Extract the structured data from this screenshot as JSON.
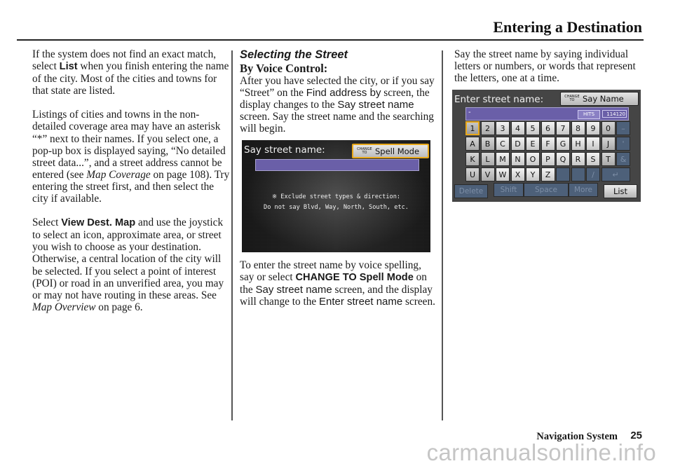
{
  "header": {
    "title": "Entering a Destination"
  },
  "column1": {
    "para1": {
      "before": "If the system does not find an exact match, select ",
      "bold": "List",
      "after": " when you finish entering the name of the city. Most of the cities and towns for that state are listed."
    },
    "para2": {
      "before": "Listings of cities and towns in the non-detailed coverage area may have an asterisk “*” next to their names. If you select one, a pop-up box is displayed saying, “No detailed street data...”, and a street address cannot be entered (see ",
      "italic": "Map Coverage",
      "after": " on page 108). Try entering the street first, and then select the city if available."
    },
    "para3": {
      "before": "Select ",
      "bold": "View Dest. Map",
      "middle": " and use the joystick to select an icon, approximate area, or street you wish to choose as your destination. Otherwise, a central location of the city will be selected. If you select a point of interest (POI) or road in an unverified area, you may or may not have routing in these areas. See ",
      "italic": "Map Overview",
      "after": " on page 6."
    }
  },
  "column2": {
    "section_heading": "Selecting the Street",
    "sub_heading": "By Voice Control:",
    "para1": {
      "t1": "After you have selected the city, or if you say “Street” on the ",
      "s1": "Find address by",
      "t2": " screen, the display changes to the ",
      "s2": "Say street name",
      "t3": " screen. Say the street name and the searching will begin."
    },
    "para2": {
      "t1": "To enter the street name by voice spelling, say or select ",
      "b1": "CHANGE TO Spell Mode",
      "t2": " on the ",
      "s1": "Say street name",
      "t3": " screen, and the display will change to the ",
      "s2": "Enter street name",
      "t4": " screen."
    }
  },
  "voice_screen": {
    "title": "Say street name:",
    "change_small_line1": "CHANGE",
    "change_small_line2": "TO",
    "change_label": "Spell Mode",
    "input_value": "",
    "note_line1": "※ Exclude street types & direction:",
    "note_line2": "Do not say Blvd, Way, North, South, etc.",
    "highlight_color": "#e8a81a",
    "input_color": "#6a5fa8"
  },
  "column3": {
    "para1": "Say the street name by saying individual letters or numbers, or words that represent the letters, one at a time."
  },
  "keyboard_screen": {
    "title": "Enter street name:",
    "change_small_line1": "CHANGE",
    "change_small_line2": "TO",
    "change_label": "Say Name",
    "input_value": "-",
    "hits_label": "HITS",
    "hits_value": "114120",
    "rows": [
      [
        "1",
        "2",
        "3",
        "4",
        "5",
        "6",
        "7",
        "8",
        "9",
        "0",
        "–"
      ],
      [
        "A",
        "B",
        "C",
        "D",
        "E",
        "F",
        "G",
        "H",
        "I",
        "J",
        "'"
      ],
      [
        "K",
        "L",
        "M",
        "N",
        "O",
        "P",
        "Q",
        "R",
        "S",
        "T",
        "&"
      ],
      [
        "U",
        "V",
        "W",
        "X",
        "Y",
        "Z",
        "",
        "",
        "/",
        "↵"
      ]
    ],
    "selected_key": "1",
    "function_keys": {
      "delete": "Delete",
      "shift": "Shift",
      "space": "Space",
      "more": "More",
      "list": "List"
    }
  },
  "footer": {
    "label": "Navigation System",
    "page_number": "25",
    "watermark": "carmanualsonline.info"
  }
}
